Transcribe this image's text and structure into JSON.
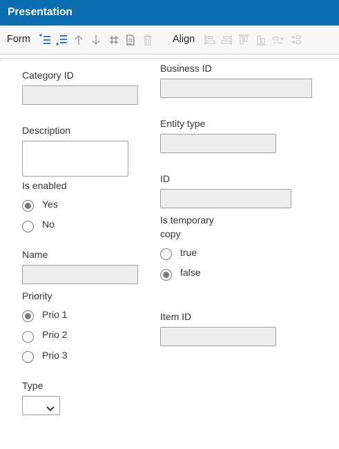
{
  "header": {
    "title": "Presentation"
  },
  "toolbar": {
    "form_label": "Form",
    "align_label": "Align",
    "form_icons": [
      "add-row-above-icon",
      "add-row-below-icon",
      "move-up-icon",
      "move-down-icon",
      "grid-icon",
      "document-icon",
      "trash-icon"
    ],
    "align_icons": [
      "align-left-icon",
      "align-right-icon",
      "align-top-icon",
      "align-bottom-icon",
      "distribute-horizontal-icon",
      "distribute-vertical-icon"
    ]
  },
  "form": {
    "category_id": {
      "label": "Category ID",
      "value": ""
    },
    "description": {
      "label": "Description",
      "value": ""
    },
    "is_enabled": {
      "label": "Is enabled",
      "options": [
        "Yes",
        "No"
      ],
      "selected": "Yes"
    },
    "name": {
      "label": "Name",
      "value": ""
    },
    "priority": {
      "label": "Priority",
      "options": [
        "Prio 1",
        "Prio 2",
        "Prio 3"
      ],
      "selected": "Prio 1"
    },
    "type": {
      "label": "Type",
      "value": ""
    },
    "business_id": {
      "label": "Business ID",
      "value": ""
    },
    "entity_type": {
      "label": "Entity type",
      "value": ""
    },
    "id": {
      "label": "ID",
      "value": ""
    },
    "is_temporary_copy": {
      "label_line1": "Is temporary",
      "label_line2": "copy",
      "options": [
        "true",
        "false"
      ],
      "selected": "false"
    },
    "item_id": {
      "label": "Item ID",
      "value": ""
    }
  }
}
